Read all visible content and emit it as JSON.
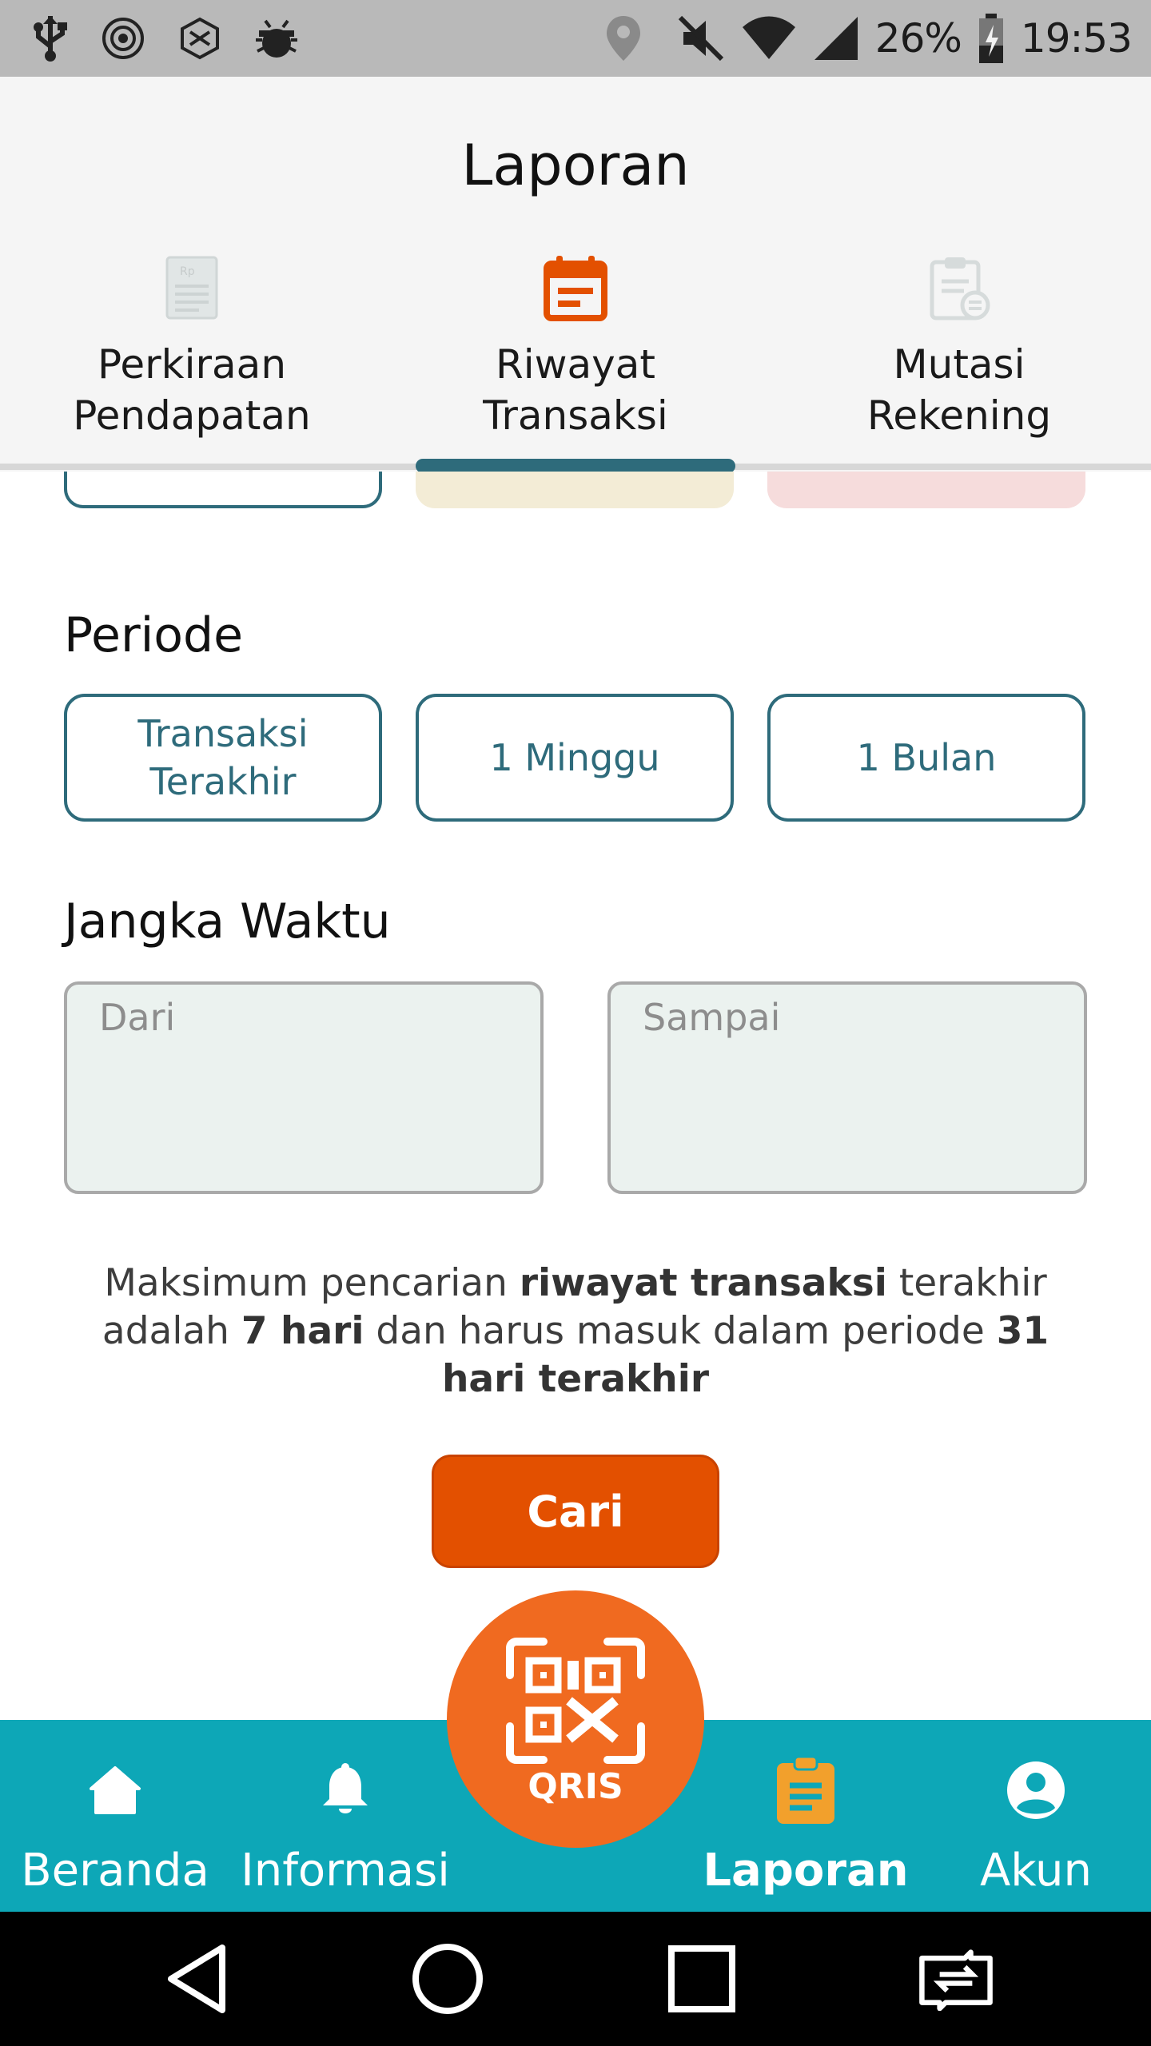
{
  "status_bar": {
    "left_icons": [
      "usb-icon",
      "settings-notif-icon",
      "hex-notif-icon",
      "android-debug-icon"
    ],
    "right_icons": [
      "location-icon",
      "mute-icon",
      "wifi-icon",
      "signal-icon",
      "battery-charging-icon"
    ],
    "battery": "26%",
    "time": "19:53"
  },
  "header": {
    "title": "Laporan",
    "tabs": [
      {
        "line1": "Perkiraan",
        "line2": "Pendapatan",
        "icon": "receipt-icon",
        "active": false
      },
      {
        "line1": "Riwayat",
        "line2": "Transaksi",
        "icon": "calendar-icon",
        "active": true
      },
      {
        "line1": "Mutasi",
        "line2": "Rekening",
        "icon": "clipboard-transfer-icon",
        "active": false
      }
    ]
  },
  "periode": {
    "title": "Periode",
    "options": [
      {
        "line1": "Transaksi",
        "line2": "Terakhir"
      },
      {
        "label": "1 Minggu"
      },
      {
        "label": "1 Bulan"
      }
    ]
  },
  "jangka_waktu": {
    "title": "Jangka Waktu",
    "from_placeholder": "Dari",
    "to_placeholder": "Sampai"
  },
  "note": {
    "p1": "Maksimum pencarian ",
    "b1": "riwayat transaksi",
    "p2": " terakhir adalah ",
    "b2": "7 hari",
    "p3": " dan harus masuk dalam periode ",
    "b3": "31 hari terakhir"
  },
  "search_button": "Cari",
  "bottom_nav": {
    "items": [
      {
        "label": "Beranda",
        "icon": "home-icon"
      },
      {
        "label": "Informasi",
        "icon": "bell-icon"
      },
      {
        "label": "Laporan",
        "icon": "report-icon",
        "active": true
      },
      {
        "label": "Akun",
        "icon": "account-icon"
      }
    ],
    "fab_logo_text": "QRIS"
  },
  "system_nav": [
    "back-icon",
    "home-circle-icon",
    "recents-icon",
    "switch-app-icon"
  ],
  "colors": {
    "accent_teal": "#2e6b7b",
    "nav_teal": "#0da7b7",
    "orange": "#e35000",
    "fab_orange": "#f06a20"
  }
}
